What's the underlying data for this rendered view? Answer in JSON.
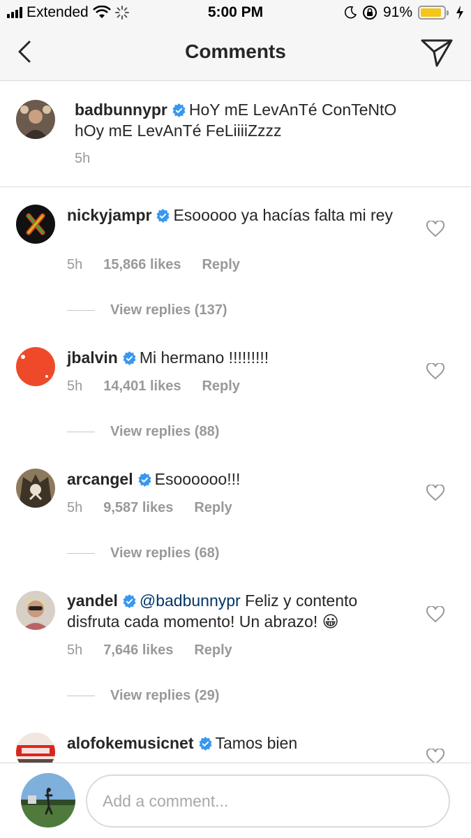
{
  "status_bar": {
    "carrier": "Extended",
    "time": "5:00 PM",
    "battery_percent": "91%",
    "battery_level": 0.91,
    "battery_color": "#f5c518",
    "icons": [
      "signal-icon",
      "wifi-icon",
      "loading-icon",
      "moon-icon",
      "orientation-lock-icon",
      "battery-icon",
      "charging-icon"
    ]
  },
  "nav": {
    "title": "Comments",
    "back_icon": "chevron-left-icon",
    "send_icon": "paper-plane-icon"
  },
  "caption": {
    "username": "badbunnypr",
    "verified": true,
    "text": "HoY mE LevAnTé ConTeNtO hOy mE LevAnTé FeLiiiiZzzz",
    "time": "5h"
  },
  "comments": [
    {
      "username": "nickyjampr",
      "verified": true,
      "text": "Esooooo  ya hacías falta mi rey",
      "time": "5h",
      "likes": "15,866 likes",
      "reply_label": "Reply",
      "view_replies": "View replies (137)"
    },
    {
      "username": "jbalvin",
      "verified": true,
      "text": "Mi hermano !!!!!!!!!",
      "time": "5h",
      "likes": "14,401 likes",
      "reply_label": "Reply",
      "view_replies": "View replies (88)"
    },
    {
      "username": "arcangel",
      "verified": true,
      "text": "Esoooooo!!!",
      "time": "5h",
      "likes": "9,587 likes",
      "reply_label": "Reply",
      "view_replies": "View replies (68)"
    },
    {
      "username": "yandel",
      "verified": true,
      "mention": "@badbunnypr",
      "text": "Feliz y contento disfruta cada momento! Un abrazo! 😀",
      "time": "5h",
      "likes": "7,646 likes",
      "reply_label": "Reply",
      "view_replies": "View replies (29)"
    },
    {
      "username": "alofokemusicnet",
      "verified": true,
      "text": "Tamos bien"
    }
  ],
  "composer": {
    "placeholder": "Add a comment..."
  },
  "colors": {
    "verified_badge": "#3897f0",
    "link": "#003569",
    "muted": "#999999"
  }
}
